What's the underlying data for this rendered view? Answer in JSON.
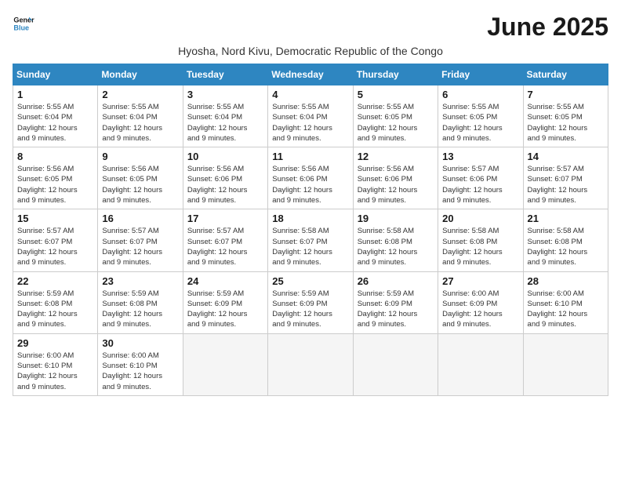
{
  "logo": {
    "line1": "General",
    "line2": "Blue"
  },
  "title": "June 2025",
  "subtitle": "Hyosha, Nord Kivu, Democratic Republic of the Congo",
  "days_of_week": [
    "Sunday",
    "Monday",
    "Tuesday",
    "Wednesday",
    "Thursday",
    "Friday",
    "Saturday"
  ],
  "weeks": [
    [
      {
        "day": 1,
        "info": "Sunrise: 5:55 AM\nSunset: 6:04 PM\nDaylight: 12 hours\nand 9 minutes."
      },
      {
        "day": 2,
        "info": "Sunrise: 5:55 AM\nSunset: 6:04 PM\nDaylight: 12 hours\nand 9 minutes."
      },
      {
        "day": 3,
        "info": "Sunrise: 5:55 AM\nSunset: 6:04 PM\nDaylight: 12 hours\nand 9 minutes."
      },
      {
        "day": 4,
        "info": "Sunrise: 5:55 AM\nSunset: 6:04 PM\nDaylight: 12 hours\nand 9 minutes."
      },
      {
        "day": 5,
        "info": "Sunrise: 5:55 AM\nSunset: 6:05 PM\nDaylight: 12 hours\nand 9 minutes."
      },
      {
        "day": 6,
        "info": "Sunrise: 5:55 AM\nSunset: 6:05 PM\nDaylight: 12 hours\nand 9 minutes."
      },
      {
        "day": 7,
        "info": "Sunrise: 5:55 AM\nSunset: 6:05 PM\nDaylight: 12 hours\nand 9 minutes."
      }
    ],
    [
      {
        "day": 8,
        "info": "Sunrise: 5:56 AM\nSunset: 6:05 PM\nDaylight: 12 hours\nand 9 minutes."
      },
      {
        "day": 9,
        "info": "Sunrise: 5:56 AM\nSunset: 6:05 PM\nDaylight: 12 hours\nand 9 minutes."
      },
      {
        "day": 10,
        "info": "Sunrise: 5:56 AM\nSunset: 6:06 PM\nDaylight: 12 hours\nand 9 minutes."
      },
      {
        "day": 11,
        "info": "Sunrise: 5:56 AM\nSunset: 6:06 PM\nDaylight: 12 hours\nand 9 minutes."
      },
      {
        "day": 12,
        "info": "Sunrise: 5:56 AM\nSunset: 6:06 PM\nDaylight: 12 hours\nand 9 minutes."
      },
      {
        "day": 13,
        "info": "Sunrise: 5:57 AM\nSunset: 6:06 PM\nDaylight: 12 hours\nand 9 minutes."
      },
      {
        "day": 14,
        "info": "Sunrise: 5:57 AM\nSunset: 6:07 PM\nDaylight: 12 hours\nand 9 minutes."
      }
    ],
    [
      {
        "day": 15,
        "info": "Sunrise: 5:57 AM\nSunset: 6:07 PM\nDaylight: 12 hours\nand 9 minutes."
      },
      {
        "day": 16,
        "info": "Sunrise: 5:57 AM\nSunset: 6:07 PM\nDaylight: 12 hours\nand 9 minutes."
      },
      {
        "day": 17,
        "info": "Sunrise: 5:57 AM\nSunset: 6:07 PM\nDaylight: 12 hours\nand 9 minutes."
      },
      {
        "day": 18,
        "info": "Sunrise: 5:58 AM\nSunset: 6:07 PM\nDaylight: 12 hours\nand 9 minutes."
      },
      {
        "day": 19,
        "info": "Sunrise: 5:58 AM\nSunset: 6:08 PM\nDaylight: 12 hours\nand 9 minutes."
      },
      {
        "day": 20,
        "info": "Sunrise: 5:58 AM\nSunset: 6:08 PM\nDaylight: 12 hours\nand 9 minutes."
      },
      {
        "day": 21,
        "info": "Sunrise: 5:58 AM\nSunset: 6:08 PM\nDaylight: 12 hours\nand 9 minutes."
      }
    ],
    [
      {
        "day": 22,
        "info": "Sunrise: 5:59 AM\nSunset: 6:08 PM\nDaylight: 12 hours\nand 9 minutes."
      },
      {
        "day": 23,
        "info": "Sunrise: 5:59 AM\nSunset: 6:08 PM\nDaylight: 12 hours\nand 9 minutes."
      },
      {
        "day": 24,
        "info": "Sunrise: 5:59 AM\nSunset: 6:09 PM\nDaylight: 12 hours\nand 9 minutes."
      },
      {
        "day": 25,
        "info": "Sunrise: 5:59 AM\nSunset: 6:09 PM\nDaylight: 12 hours\nand 9 minutes."
      },
      {
        "day": 26,
        "info": "Sunrise: 5:59 AM\nSunset: 6:09 PM\nDaylight: 12 hours\nand 9 minutes."
      },
      {
        "day": 27,
        "info": "Sunrise: 6:00 AM\nSunset: 6:09 PM\nDaylight: 12 hours\nand 9 minutes."
      },
      {
        "day": 28,
        "info": "Sunrise: 6:00 AM\nSunset: 6:10 PM\nDaylight: 12 hours\nand 9 minutes."
      }
    ],
    [
      {
        "day": 29,
        "info": "Sunrise: 6:00 AM\nSunset: 6:10 PM\nDaylight: 12 hours\nand 9 minutes."
      },
      {
        "day": 30,
        "info": "Sunrise: 6:00 AM\nSunset: 6:10 PM\nDaylight: 12 hours\nand 9 minutes."
      },
      null,
      null,
      null,
      null,
      null
    ]
  ]
}
